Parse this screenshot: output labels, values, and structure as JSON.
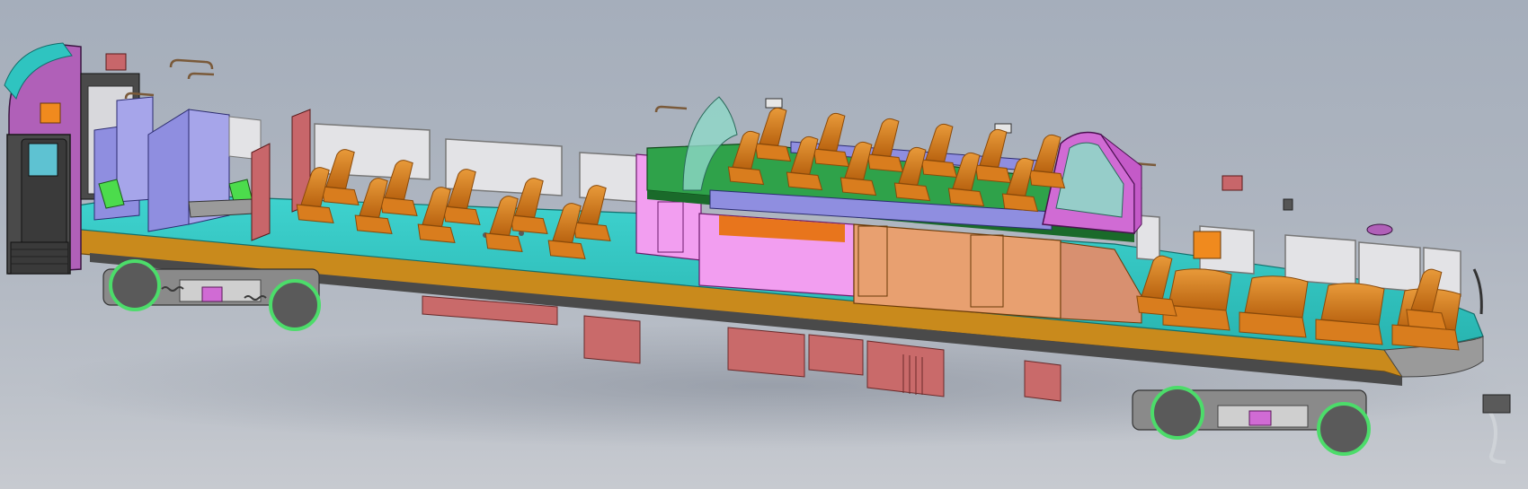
{
  "viewport": {
    "background_top": "#a5aebb",
    "background_bottom": "#c7cad0"
  },
  "model": {
    "subject": "railcar-dome-cutaway",
    "colors": {
      "floor_top": "#2ec4c0",
      "floor_side": "#c98a1c",
      "frame": "#4a4a4a",
      "truck": "#6c6c6c",
      "wheel_accent": "#4cdc6a",
      "seat": "#d97d1e",
      "seat_dark": "#8a4a0a",
      "dome_floor": "#2fa24a",
      "dome_wall_pink": "#f29ef0",
      "partition_purple": "#8f8ee0",
      "partition_red": "#c8666a",
      "window": "#e3e3e6",
      "undercar_box": "#c96a6a",
      "cab_body": "#b060b8",
      "cab_face": "#4a4a4a",
      "lounge_wall": "#e8a070",
      "glass": "#8fd8c8"
    },
    "icons": [
      "seat-icon",
      "wheel-icon",
      "window-icon",
      "door-icon",
      "lamp-icon"
    ]
  }
}
